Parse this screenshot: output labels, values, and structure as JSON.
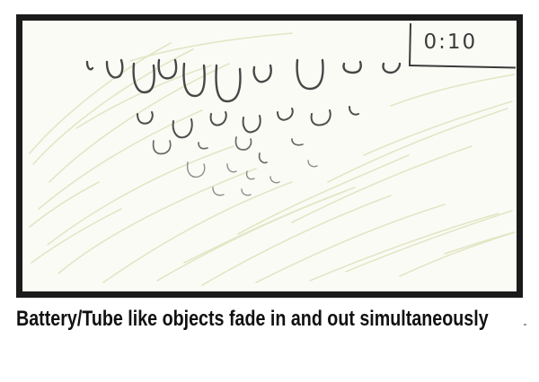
{
  "storyboard": {
    "timecode": "0:10",
    "caption": "Battery/Tube like objects fade in and out simultaneously"
  },
  "colors": {
    "frame_border": "#1b1b1b",
    "pencil": "#4a4a4a",
    "hatching": "#e2e6c4",
    "caption_text": "#111111"
  }
}
